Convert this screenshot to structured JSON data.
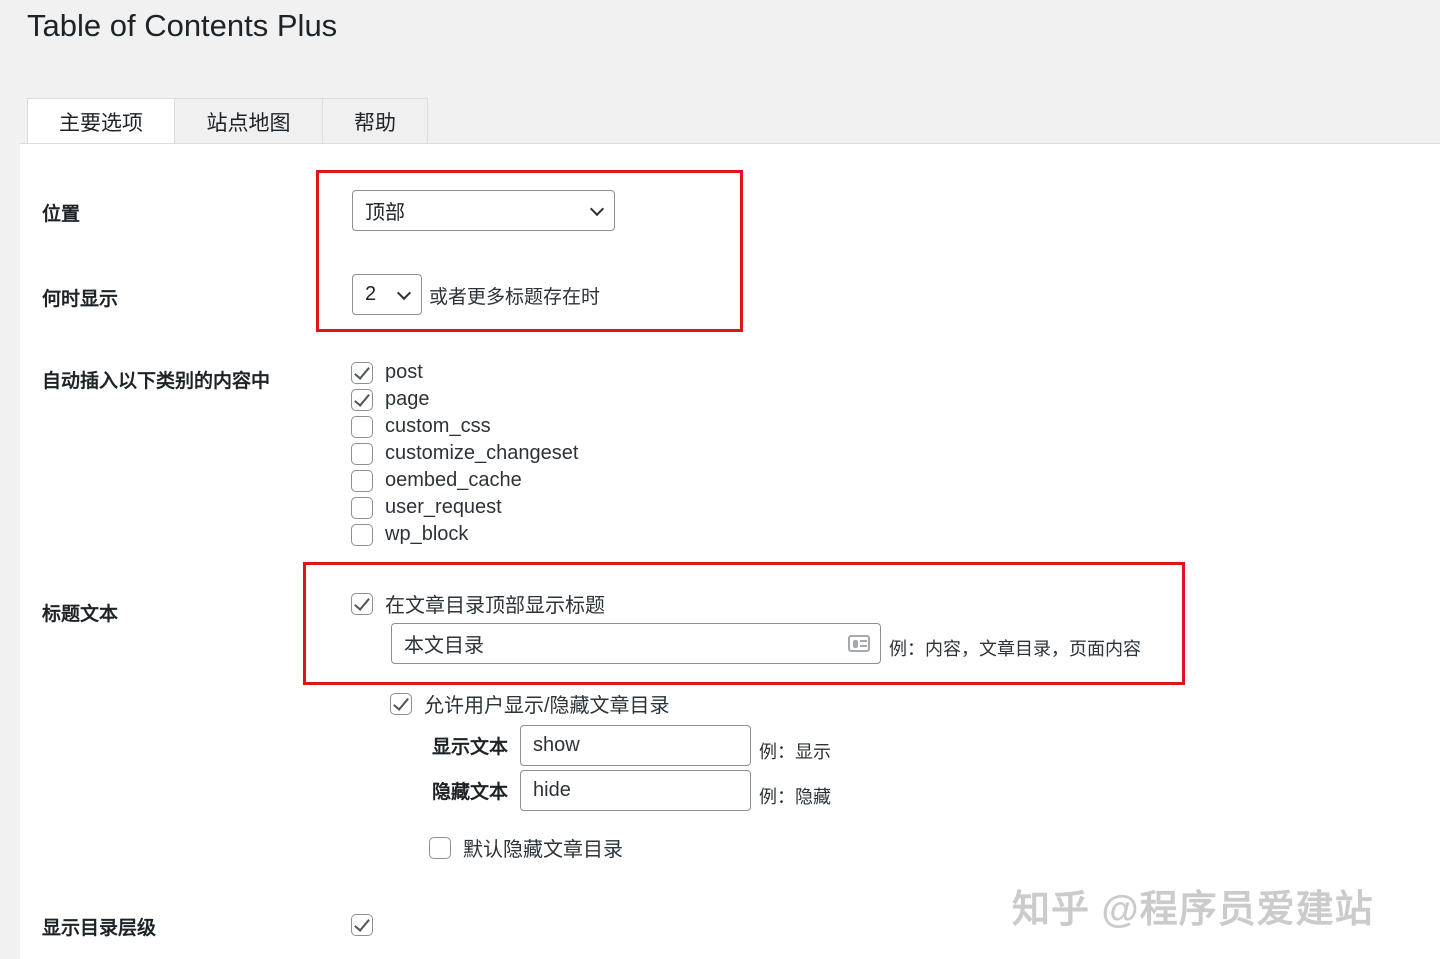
{
  "page_title": "Table of Contents Plus",
  "tabs": [
    {
      "label": "主要选项",
      "active": true
    },
    {
      "label": "站点地图"
    },
    {
      "label": "帮助"
    }
  ],
  "position": {
    "label": "位置",
    "value": "顶部"
  },
  "show_when": {
    "label": "何时显示",
    "value": "2",
    "suffix": "或者更多标题存在时"
  },
  "auto_insert": {
    "label": "自动插入以下类别的内容中",
    "items": [
      {
        "label": "post",
        "checked": true
      },
      {
        "label": "page",
        "checked": true
      },
      {
        "label": "custom_css",
        "checked": false
      },
      {
        "label": "customize_changeset",
        "checked": false
      },
      {
        "label": "oembed_cache",
        "checked": false
      },
      {
        "label": "user_request",
        "checked": false
      },
      {
        "label": "wp_block",
        "checked": false
      }
    ]
  },
  "heading_text": {
    "label": "标题文本",
    "show_title_label": "在文章目录顶部显示标题",
    "show_title_checked": true,
    "title_value": "本文目录",
    "title_hint": "例：内容，文章目录，页面内容",
    "allow_toggle_label": "允许用户显示/隐藏文章目录",
    "allow_toggle_checked": true,
    "show_text_label": "显示文本",
    "show_text_value": "show",
    "show_text_hint": "例：显示",
    "hide_text_label": "隐藏文本",
    "hide_text_value": "hide",
    "hide_text_hint": "例：隐藏",
    "hide_default_label": "默认隐藏文章目录",
    "hide_default_checked": false
  },
  "show_hierarchy": {
    "label": "显示目录层级",
    "checked": true
  },
  "watermark": "知乎 @程序员爱建站",
  "colors": {
    "highlight": "#e0141e",
    "background": "#f1f1f1"
  }
}
